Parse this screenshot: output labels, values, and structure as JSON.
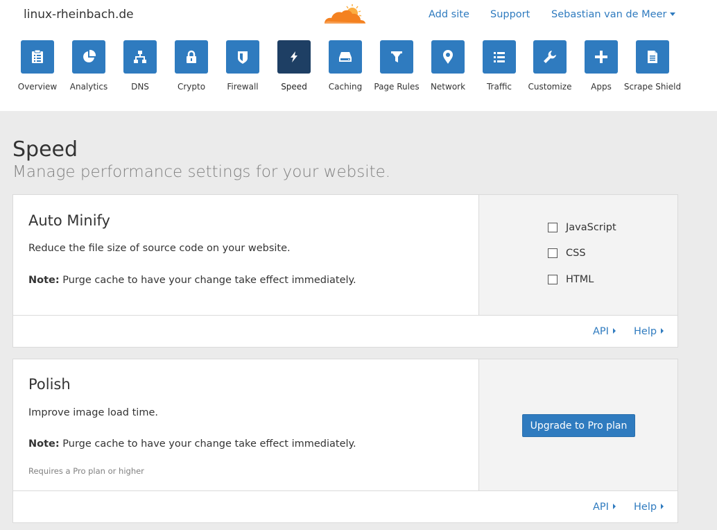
{
  "header": {
    "domain": "linux-rheinbach.de",
    "links": {
      "add_site": "Add site",
      "support": "Support",
      "user": "Sebastian van de Meer"
    }
  },
  "nav": {
    "items": [
      {
        "label": "Overview",
        "icon": "overview-icon"
      },
      {
        "label": "Analytics",
        "icon": "pie-chart-icon"
      },
      {
        "label": "DNS",
        "icon": "network-tree-icon"
      },
      {
        "label": "Crypto",
        "icon": "lock-icon"
      },
      {
        "label": "Firewall",
        "icon": "shield-icon"
      },
      {
        "label": "Speed",
        "icon": "lightning-icon",
        "active": true
      },
      {
        "label": "Caching",
        "icon": "hard-drive-icon"
      },
      {
        "label": "Page Rules",
        "icon": "filter-icon"
      },
      {
        "label": "Network",
        "icon": "map-pin-icon"
      },
      {
        "label": "Traffic",
        "icon": "list-icon"
      },
      {
        "label": "Customize",
        "icon": "wrench-icon"
      },
      {
        "label": "Apps",
        "icon": "plus-icon"
      },
      {
        "label": "Scrape Shield",
        "icon": "document-icon"
      }
    ]
  },
  "page": {
    "title": "Speed",
    "subtitle": "Manage performance settings for your website."
  },
  "cards": {
    "auto_minify": {
      "title": "Auto Minify",
      "description": "Reduce the file size of source code on your website.",
      "note_label": "Note:",
      "note_text": " Purge cache to have your change take effect immediately.",
      "options": [
        {
          "label": "JavaScript",
          "checked": false
        },
        {
          "label": "CSS",
          "checked": false
        },
        {
          "label": "HTML",
          "checked": false
        }
      ],
      "api_link": "API",
      "help_link": "Help"
    },
    "polish": {
      "title": "Polish",
      "description": "Improve image load time.",
      "note_label": "Note:",
      "note_text": " Purge cache to have your change take effect immediately.",
      "requirement": "Requires a Pro plan or higher",
      "upgrade_button": "Upgrade to Pro plan",
      "api_link": "API",
      "help_link": "Help"
    }
  },
  "colors": {
    "accent": "#2f7bbf",
    "active_nav": "#1e3f64",
    "logo_orange": "#f48120",
    "background": "#ebebeb"
  }
}
